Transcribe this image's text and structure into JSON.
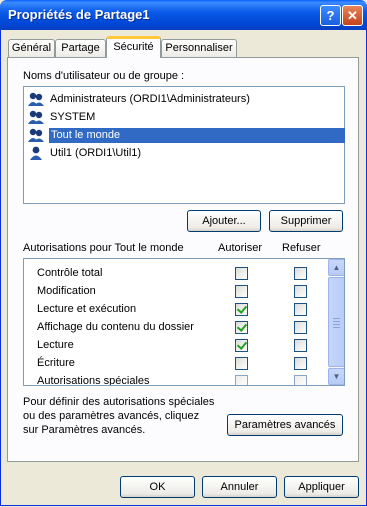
{
  "window": {
    "title": "Propriétés de Partage1",
    "help_glyph": "?",
    "close_glyph": "✕"
  },
  "tabs": [
    {
      "label": "Général",
      "active": false
    },
    {
      "label": "Partage",
      "active": false
    },
    {
      "label": "Sécurité",
      "active": true
    },
    {
      "label": "Personnaliser",
      "active": false
    }
  ],
  "users": {
    "label": "Noms d'utilisateur ou de groupe :",
    "items": [
      {
        "name": "Administrateurs (ORDI1\\Administrateurs)",
        "selected": false
      },
      {
        "name": "SYSTEM",
        "selected": false
      },
      {
        "name": "Tout le monde",
        "selected": true
      },
      {
        "name": "Util1 (ORDI1\\Util1)",
        "selected": false
      }
    ],
    "add_label": "Ajouter...",
    "remove_label": "Supprimer"
  },
  "permissions": {
    "label": "Autorisations pour Tout le monde",
    "allow_header": "Autoriser",
    "deny_header": "Refuser",
    "rows": [
      {
        "name": "Contrôle total",
        "allow": false,
        "deny": false
      },
      {
        "name": "Modification",
        "allow": false,
        "deny": false
      },
      {
        "name": "Lecture et exécution",
        "allow": true,
        "deny": false
      },
      {
        "name": "Affichage du contenu du dossier",
        "allow": true,
        "deny": false
      },
      {
        "name": "Lecture",
        "allow": true,
        "deny": false
      },
      {
        "name": "Écriture",
        "allow": false,
        "deny": false
      },
      {
        "name": "Autorisations spéciales",
        "allow": false,
        "deny": false
      }
    ]
  },
  "advanced": {
    "text": [
      "Pour définir des autorisations spéciales",
      "ou des paramètres avancés, cliquez",
      "sur Paramètres avancés."
    ],
    "button_label": "Paramètres avancés"
  },
  "footer": {
    "ok": "OK",
    "cancel": "Annuler",
    "apply": "Appliquer"
  },
  "colors": {
    "title_bar": "#0054e3",
    "selection": "#316ac5",
    "tab_highlight": "#ffc73c"
  }
}
